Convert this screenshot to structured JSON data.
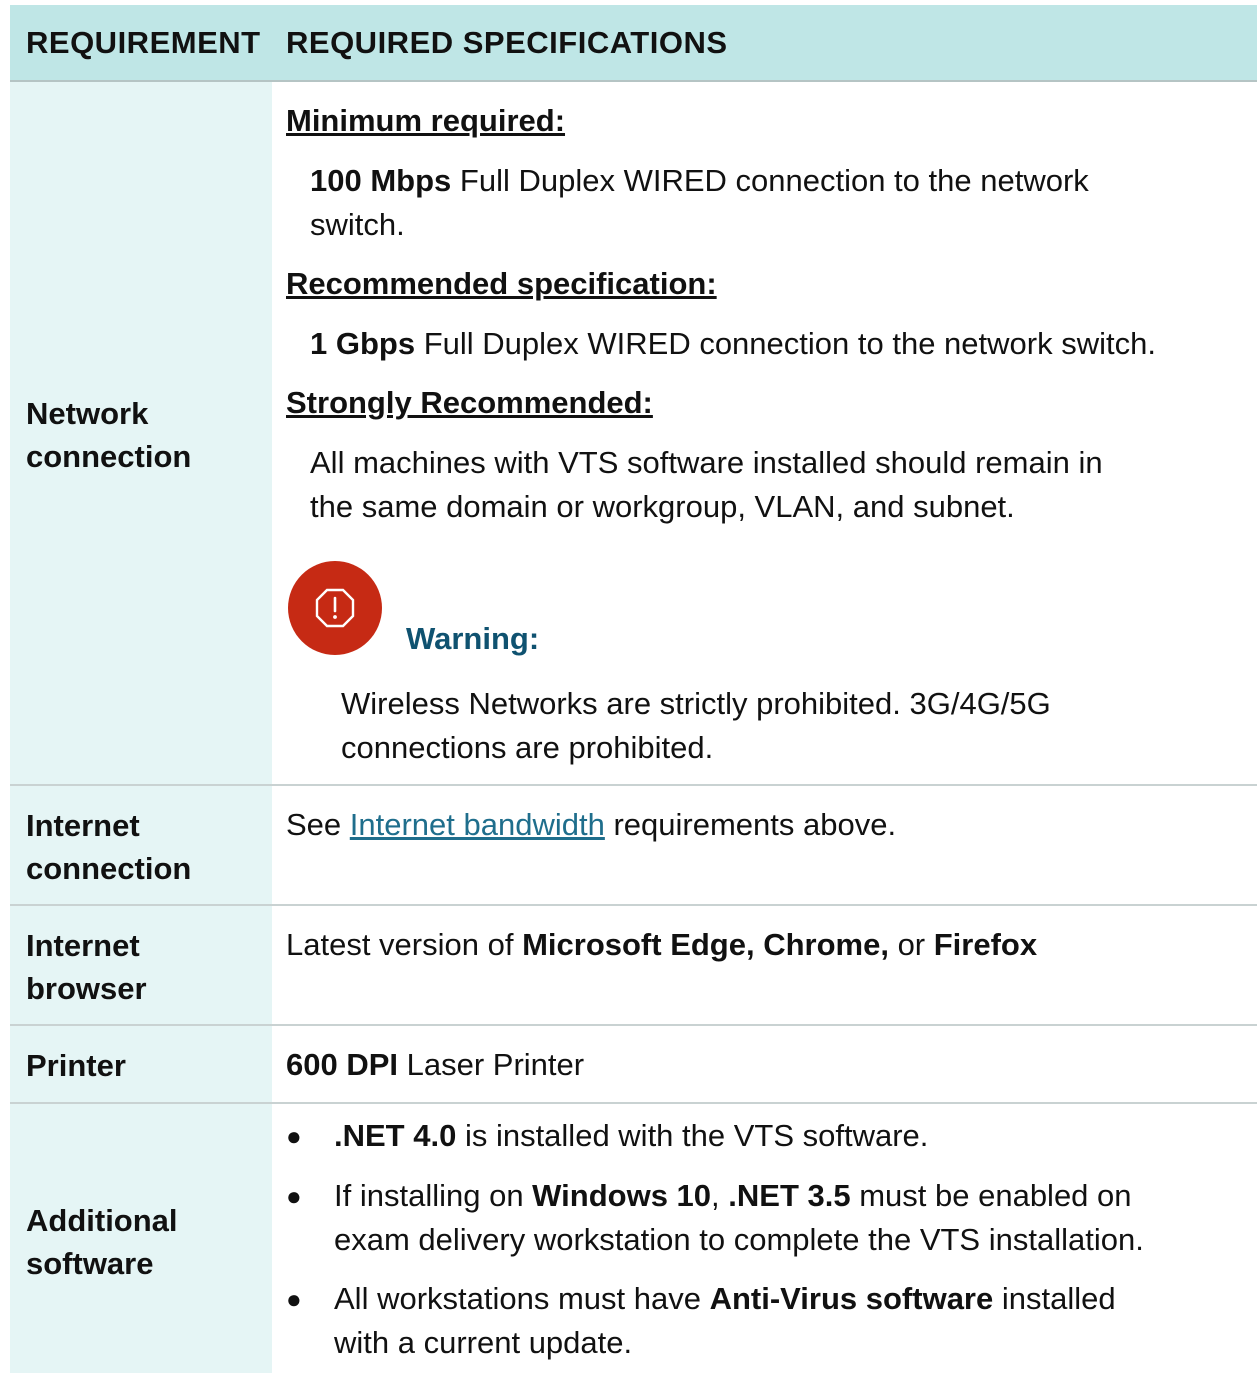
{
  "header": {
    "col1": "REQUIREMENT",
    "col2": "REQUIRED SPECIFICATIONS"
  },
  "network": {
    "label1": "Network",
    "label2": "connection",
    "min_title": "Minimum required:",
    "min_bold": "100 Mbps",
    "min_text1": " Full Duplex WIRED connection to the network",
    "min_text2": "switch.",
    "rec_title": "Recommended specification:",
    "rec_bold": "1 Gbps",
    "rec_text": " Full Duplex WIRED connection to the network switch.",
    "strong_title": "Strongly Recommended:",
    "strong_text1": "All machines with VTS software installed should remain in",
    "strong_text2": "the same domain or workgroup, VLAN, and subnet.",
    "warning_title": "Warning:",
    "warning_text1": "Wireless Networks are strictly prohibited. 3G/4G/5G",
    "warning_text2": "connections are prohibited.",
    "warning_icon": "warning-octagon-icon",
    "warning_color": "#c62a14"
  },
  "internet": {
    "label1": "Internet",
    "label2": "connection",
    "see": "See ",
    "link": "Internet bandwidth",
    "rest": " requirements above."
  },
  "browser": {
    "label1": "Internet",
    "label2": "browser",
    "pre": "Latest version of ",
    "b1": "Microsoft Edge, Chrome,",
    "mid": " or ",
    "b2": "Firefox"
  },
  "printer": {
    "label": "Printer",
    "bold": "600 DPI",
    "text": " Laser Printer"
  },
  "software": {
    "label1": "Additional",
    "label2": "software",
    "b1_bold": ".NET 4.0",
    "b1_text": " is installed with the VTS software.",
    "b2_pre": "If installing on ",
    "b2_bold1": "Windows 10",
    "b2_comma": ", ",
    "b2_bold2": ".NET 3.5",
    "b2_text": " must be enabled on",
    "b2_line2": "exam delivery workstation to complete the VTS installation.",
    "b3_pre": "All workstations must have ",
    "b3_bold": "Anti-Virus software",
    "b3_text": " installed",
    "b3_line2": "with a current update.",
    "bullet": "●"
  }
}
